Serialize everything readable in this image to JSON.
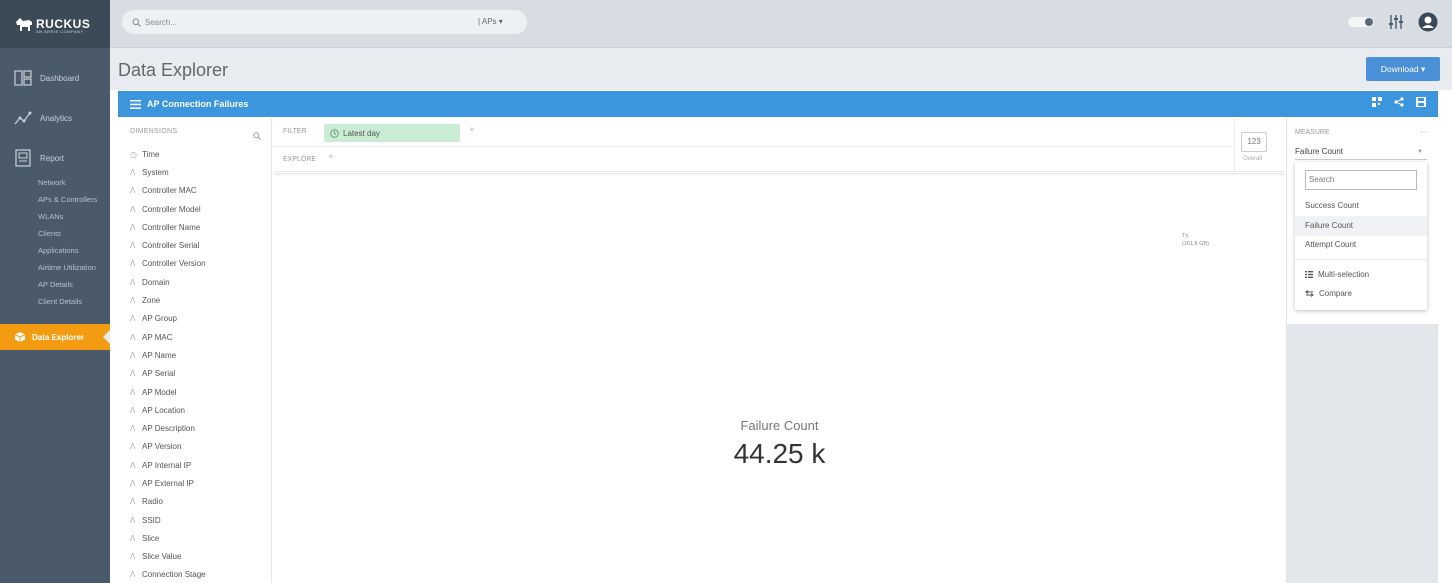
{
  "brand": {
    "name": "RUCKUS",
    "tagline": "AN ARRIS COMPANY"
  },
  "sidebar": {
    "items": [
      {
        "label": "Dashboard",
        "icon": "dashboard-icon"
      },
      {
        "label": "Analytics",
        "icon": "analytics-icon"
      },
      {
        "label": "Report",
        "icon": "report-icon"
      }
    ],
    "report_subitems": [
      "Network",
      "APs & Controllers",
      "WLANs",
      "Clients",
      "Applications",
      "Airtime Utilization",
      "AP Details",
      "Client Details"
    ],
    "active": {
      "label": "Data Explorer",
      "icon": "cube-icon"
    }
  },
  "topbar": {
    "search_placeholder": "Search...",
    "scope": "| APs ▾"
  },
  "page": {
    "title": "Data Explorer",
    "download_label": "Download ▾"
  },
  "panel": {
    "title": "AP Connection Failures"
  },
  "dimensions": {
    "header": "DIMENSIONS",
    "items": [
      "Time",
      "System",
      "Controller MAC",
      "Controller Model",
      "Controller Name",
      "Controller Serial",
      "Controller Version",
      "Domain",
      "Zone",
      "AP Group",
      "AP MAC",
      "AP Name",
      "AP Serial",
      "AP Model",
      "AP Location",
      "AP Description",
      "AP Version",
      "AP Internal IP",
      "AP External IP",
      "Radio",
      "SSID",
      "Slice",
      "Slice Value",
      "Connection Stage"
    ]
  },
  "filter": {
    "label": "FILTER",
    "chip": "Latest day"
  },
  "explore": {
    "label": "EXPLORE"
  },
  "overall": {
    "value": "123",
    "label": "Overall"
  },
  "tx": {
    "line1": "Tx",
    "line2": "(161.8 GB)"
  },
  "result": {
    "label": "Failure Count",
    "value": "44.25 k"
  },
  "measure": {
    "header": "MEASURE",
    "more": "···",
    "selected": "Failure Count",
    "search_placeholder": "Search",
    "options": [
      "Success Count",
      "Failure Count",
      "Attempt Count"
    ],
    "actions": [
      "Multi-selection",
      "Compare"
    ]
  },
  "colors": {
    "accent": "#3c96de",
    "active_nav": "#f39c12",
    "filter_chip": "#c9ecd2"
  }
}
